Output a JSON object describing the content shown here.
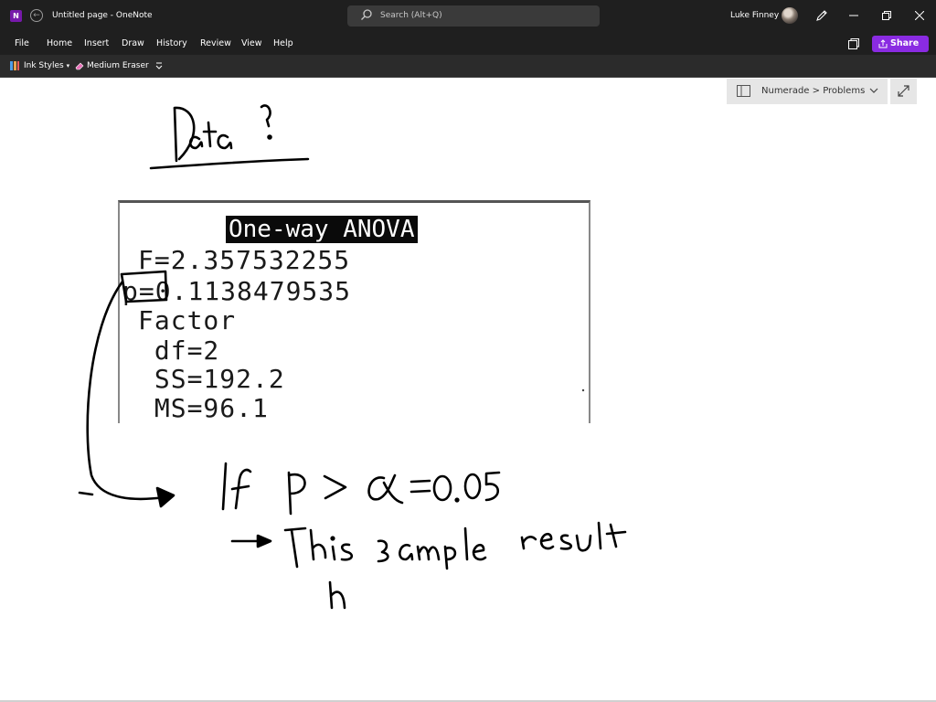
{
  "titlebar": {
    "app_icon_letter": "N",
    "title": "Untitled page - OneNote",
    "search_placeholder": "Search (Alt+Q)",
    "user_name": "Luke Finney"
  },
  "menu": {
    "items": [
      "File",
      "Home",
      "Insert",
      "Draw",
      "History",
      "Review",
      "View",
      "Help"
    ],
    "share_label": "Share"
  },
  "toolbar": {
    "ink_styles_label": "Ink Styles",
    "eraser_label": "Medium Eraser"
  },
  "notebook": {
    "breadcrumb": "Numerade > Problems"
  },
  "calculator": {
    "title": "One-way ANOVA",
    "lines": [
      "F=2.357532255",
      "p=0.1138479535",
      "Factor",
      " df=2",
      " SS=192.2",
      " MS=96.1"
    ]
  },
  "colors": {
    "titlebar_bg": "#1f1f1f",
    "toolbar_bg": "#2b2b2b",
    "share_accent": "#8a2be2",
    "app_icon": "#7719aa",
    "ink": "#000000"
  },
  "icons": [
    "onenote-app-icon",
    "back-icon",
    "search-icon",
    "pen-icon",
    "minimize-icon",
    "restore-icon",
    "close-icon",
    "sticky-notes-icon",
    "share-icon",
    "ink-styles-icon",
    "eraser-icon",
    "notebook-icon",
    "chevron-down-icon",
    "expand-icon"
  ]
}
